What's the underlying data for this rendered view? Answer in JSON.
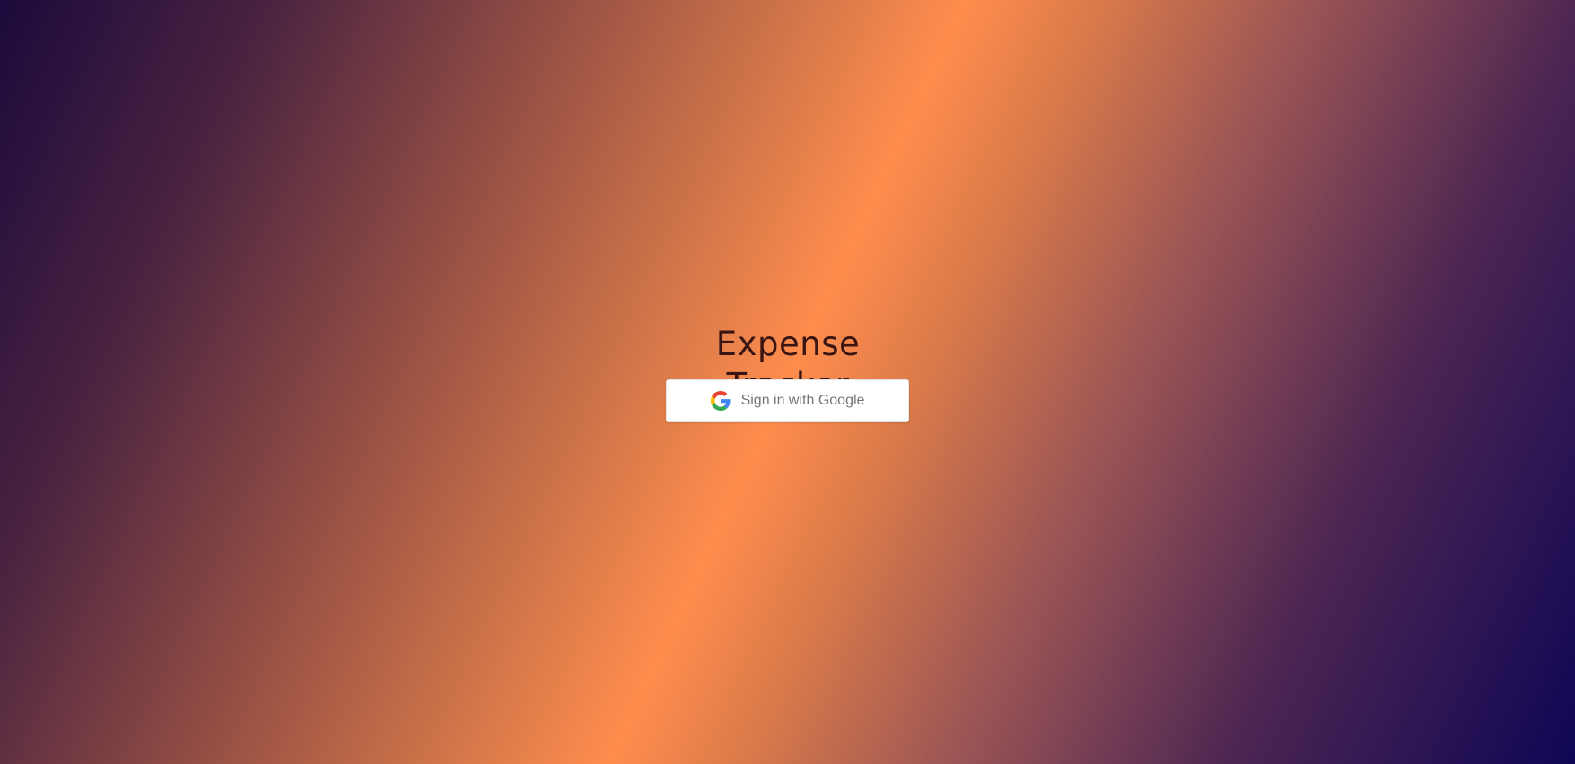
{
  "app": {
    "title": "Expense Tracker"
  },
  "auth": {
    "signin_label": "Sign in with Google",
    "provider_icon": "google-g-icon"
  },
  "colors": {
    "title_text": "#3a1512",
    "gradient_dark_left": "#1b0a3c",
    "gradient_center": "#ff8d4d",
    "gradient_dark_right": "#0e0655",
    "button_bg": "#ffffff",
    "button_text": "#757575"
  }
}
